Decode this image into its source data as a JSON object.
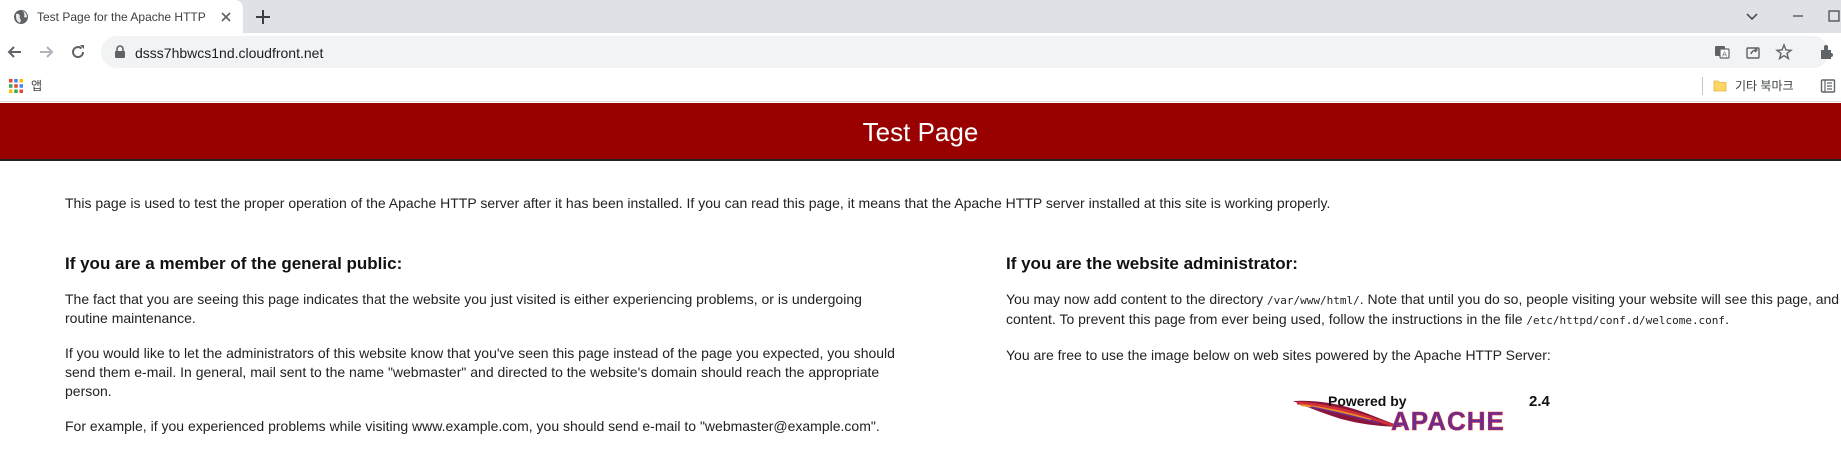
{
  "browser": {
    "tab_title": "Test Page for the Apache HTTP",
    "url": "dsss7hbwcs1nd.cloudfront.net",
    "bookmarks_bar": {
      "apps_label": "앱",
      "other_bookmarks_label": "기타 북마크"
    }
  },
  "page": {
    "header_title": "Test Page",
    "intro": "This page is used to test the proper operation of the Apache HTTP server after it has been installed. If you can read this page, it means that the Apache HTTP server installed at this site is working properly.",
    "public_section": {
      "heading": "If you are a member of the general public:",
      "p1": "The fact that you are seeing this page indicates that the website you just visited is either experiencing problems, or is undergoing routine maintenance.",
      "p2": "If you would like to let the administrators of this website know that you've seen this page instead of the page you expected, you should send them e-mail. In general, mail sent to the name \"webmaster\" and directed to the website's domain should reach the appropriate person.",
      "p3": "For example, if you experienced problems while visiting www.example.com, you should send e-mail to \"webmaster@example.com\"."
    },
    "admin_section": {
      "heading": "If you are the website administrator:",
      "p1_before": "You may now add content to the directory ",
      "p1_dir": "/var/www/html/",
      "p1_middle": ". Note that until you do so, people visiting your website will see this page, and not your content. To prevent this page from ever being used, follow the instructions in the file ",
      "p1_file": "/etc/httpd/conf.d/welcome.conf",
      "p1_after": ".",
      "p2": "You are free to use the image below on web sites powered by the Apache HTTP Server:"
    },
    "powered_by": {
      "line1": "Powered by",
      "brand": "APACHE",
      "version": "2.4"
    }
  },
  "colors": {
    "header_bg": "#990000",
    "tabstrip_bg": "#dee1e6",
    "omnibox_bg": "#f1f3f4"
  }
}
